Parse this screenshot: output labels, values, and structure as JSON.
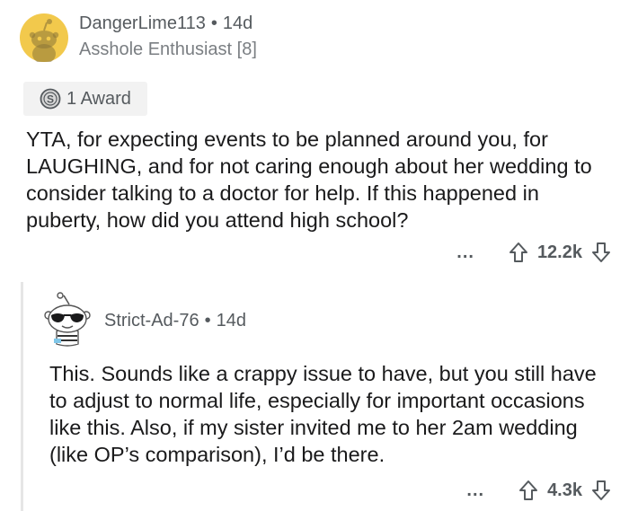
{
  "comment": {
    "username": "DangerLime113",
    "time": "14d",
    "flair": "Asshole Enthusiast [8]",
    "award_label": "1 Award",
    "body": "YTA, for expecting events to be planned around you, for LAUGHING, and for not caring enough about her wedding to consider talking to a doctor for help. If this happened in puberty, how did you attend high school?",
    "more": "...",
    "score": "12.2k"
  },
  "reply": {
    "username": "Strict-Ad-76",
    "time": "14d",
    "body": "This. Sounds like a crappy issue to have, but you still have to adjust to normal life, especially for important occasions like this. Also, if my sister invited me to her 2am wedding (like OP’s comparison), I’d be there.",
    "more": "...",
    "score": "4.3k"
  },
  "separator": "•",
  "colors": {
    "avatar_bg": "#f2c94c",
    "text": "#1a1a1b",
    "meta": "#555a5e",
    "award_bg": "#f2f2f2",
    "thread_line": "#e6e6e6"
  },
  "icons": {
    "upvote": "upvote-arrow-icon",
    "downvote": "downvote-arrow-icon",
    "award": "silver-award-icon"
  }
}
